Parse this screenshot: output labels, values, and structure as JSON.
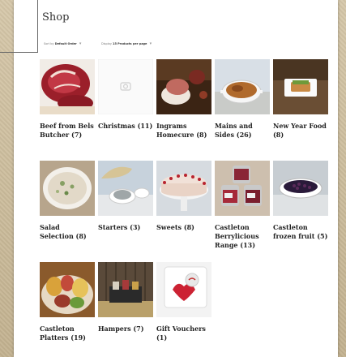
{
  "page": {
    "title": "Shop"
  },
  "controls": {
    "sort_prefix": "Sort by",
    "sort_value": "Default Order",
    "display_prefix": "Display",
    "display_value": "15 Products per page"
  },
  "categories": [
    {
      "label": "Beef from Bels Butcher (7)",
      "icon": "beef-photo"
    },
    {
      "label": "Christmas (11)",
      "icon": "placeholder-image"
    },
    {
      "label": "Ingrams Homecure (8)",
      "icon": "ham-photo"
    },
    {
      "label": "Mains and Sides (26)",
      "icon": "casserole-photo"
    },
    {
      "label": "New Year Food (8)",
      "icon": "plated-dish-photo"
    },
    {
      "label": "Salad Selection (8)",
      "icon": "salad-photo"
    },
    {
      "label": "Starters (3)",
      "icon": "starters-photo"
    },
    {
      "label": "Sweets (8)",
      "icon": "cake-photo"
    },
    {
      "label": "Castleton Berrylicious Range (13)",
      "icon": "jam-jars-photo"
    },
    {
      "label": "Castleton frozen fruit (5)",
      "icon": "berries-bowl-photo"
    },
    {
      "label": "Castleton Platters (19)",
      "icon": "platter-photo"
    },
    {
      "label": "Hampers (7)",
      "icon": "hamper-photo"
    },
    {
      "label": "Gift Vouchers (1)",
      "icon": "gift-voucher-photo"
    }
  ]
}
